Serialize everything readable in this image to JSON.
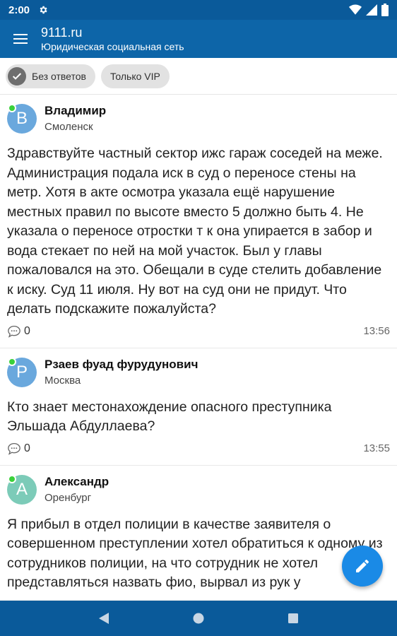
{
  "status_bar": {
    "time": "2:00",
    "icons": [
      "gear-icon",
      "wifi-icon",
      "signal-icon",
      "battery-icon"
    ]
  },
  "app_bar": {
    "title": "9111.ru",
    "subtitle": "Юридическая социальная сеть",
    "menu_icon": "hamburger-menu-icon"
  },
  "filters": [
    {
      "label": "Без ответов",
      "checked": true
    },
    {
      "label": "Только VIP",
      "checked": false
    }
  ],
  "posts": [
    {
      "avatar_letter": "В",
      "avatar_color": "#6aa8dd",
      "online": true,
      "author": "Владимир",
      "city": "Смоленск",
      "text": "Здравствуйте частный сектор ижс гараж соседей на меже. Администрация подала иск в суд о переносе стены на метр. Хотя в акте осмотра указала ещё нарушение местных правил по высоте вместо 5 должно быть 4. Не указала о переносе отростки т к она упирается в забор и вода стекает по ней на мой участок. Был у главы пожаловался на это. Обещали в суде стелить добавление к иску. Суд 11 июля. Ну вот на суд они не придут. Что делать подскажите пожалуйста?",
      "comments": "0",
      "time": "13:56"
    },
    {
      "avatar_letter": "Р",
      "avatar_color": "#6aa8dd",
      "online": true,
      "author": "Рзаев фуад фурудунович",
      "city": "Москва",
      "text": "Кто знает местонахождение опасного преступника Эльшада Абдуллаева?",
      "comments": "0",
      "time": "13:55"
    },
    {
      "avatar_letter": "А",
      "avatar_color": "#7ccbb8",
      "online": true,
      "author": "Александр",
      "city": "Оренбург",
      "text": "Я прибыл в отдел полиции в качестве заявителя о совершенном преступлении хотел обратиться к одному из сотрудников полиции, на что сотрудник не хотел представляться назвать фио, вырвал из рук у",
      "comments": "",
      "time": ""
    }
  ],
  "fab": {
    "icon": "pencil-icon"
  },
  "nav_bar": {
    "icons": [
      "back-icon",
      "home-icon",
      "recents-icon"
    ]
  }
}
